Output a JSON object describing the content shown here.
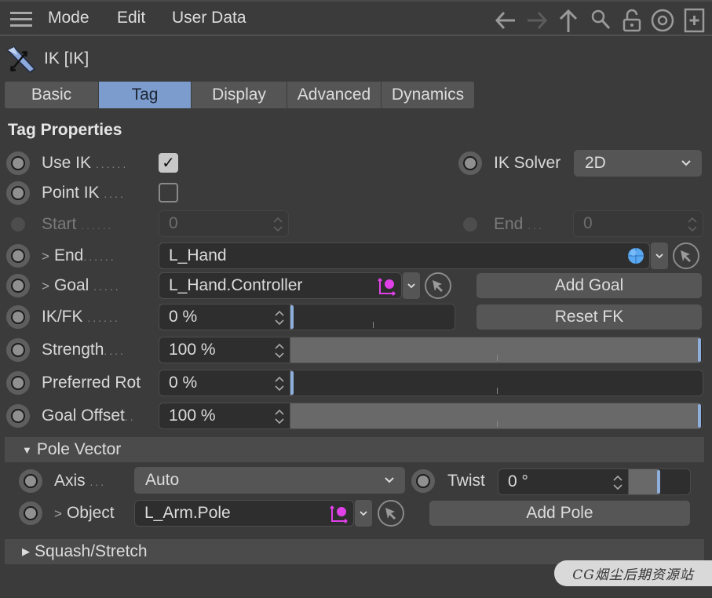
{
  "menu": {
    "items": [
      "Mode",
      "Edit",
      "User Data"
    ],
    "toolbar_icons": [
      "arrow-left-icon",
      "arrow-right-icon",
      "arrow-up-icon",
      "search-icon",
      "lock-open-icon",
      "target-icon",
      "new-panel-icon"
    ]
  },
  "object": {
    "title": "IK [IK]",
    "icon": "ik-tag-icon"
  },
  "tabs": [
    {
      "label": "Basic",
      "active": false
    },
    {
      "label": "Tag",
      "active": true
    },
    {
      "label": "Display",
      "active": false
    },
    {
      "label": "Advanced",
      "active": false
    },
    {
      "label": "Dynamics",
      "active": false
    }
  ],
  "tag_properties": {
    "title": "Tag Properties",
    "use_ik": {
      "label": "Use IK",
      "checked": true,
      "checkmark": "✓"
    },
    "point_ik": {
      "label": "Point IK",
      "checked": false
    },
    "ik_solver": {
      "label": "IK Solver",
      "value": "2D"
    },
    "start": {
      "label": "Start",
      "value": "0"
    },
    "end_index": {
      "label": "End",
      "value": "0"
    },
    "end": {
      "label": "End",
      "value": "L_Hand"
    },
    "goal": {
      "label": "Goal",
      "value": "L_Hand.Controller",
      "add_button": "Add Goal"
    },
    "ik_fk": {
      "label": "IK/FK",
      "value": "0 %",
      "fraction": 0.0,
      "reset_button": "Reset FK"
    },
    "strength": {
      "label": "Strength",
      "value": "100 %",
      "fraction": 1.0
    },
    "preferred_rot": {
      "label": "Preferred Rot",
      "value": "0 %",
      "fraction": 0.0
    },
    "goal_offset": {
      "label": "Goal Offset",
      "value": "100 %",
      "fraction": 1.0
    }
  },
  "pole_vector": {
    "title": "Pole Vector",
    "axis": {
      "label": "Axis",
      "value": "Auto"
    },
    "twist": {
      "label": "Twist",
      "value": "0 °",
      "fraction": 0.5
    },
    "object": {
      "label": "Object",
      "value": "L_Arm.Pole",
      "add_button": "Add Pole"
    }
  },
  "squash_stretch": {
    "title": "Squash/Stretch"
  },
  "watermark": "CG烟尘后期资源站",
  "colors": {
    "accent": "#7b9ccd",
    "slider_handle": "#8eaedb",
    "null_icon": "#e040e8",
    "sphere_icon": "#5aa8f0"
  }
}
